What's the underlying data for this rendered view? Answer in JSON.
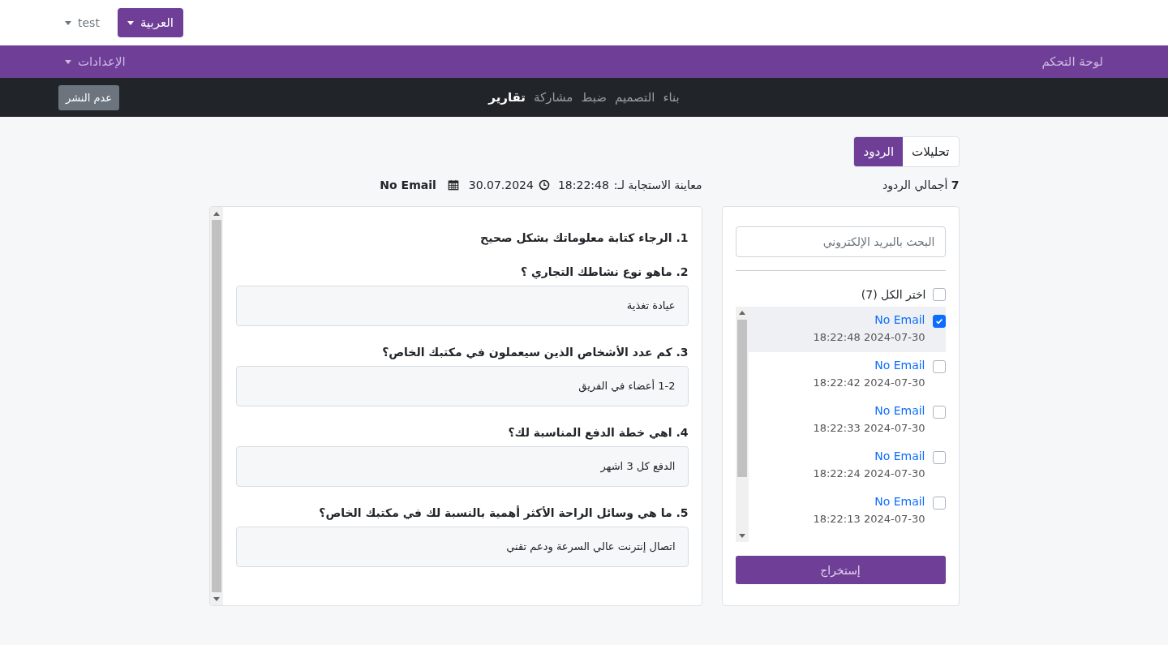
{
  "topbar": {
    "language_button": "العربية",
    "user_menu": "test"
  },
  "menubar": {
    "items": [
      {
        "label": "لوحة التحكم",
        "kind": "link"
      },
      {
        "label": "الإعدادات",
        "kind": "dropdown"
      }
    ]
  },
  "navbar": {
    "tabs": [
      {
        "label": "بناء",
        "selected": false
      },
      {
        "label": "التصميم",
        "selected": false
      },
      {
        "label": "ضبط",
        "selected": false
      },
      {
        "label": "مشاركة",
        "selected": false
      },
      {
        "label": "تقارير",
        "selected": true
      }
    ],
    "unpublish_button": "عدم النشر"
  },
  "view_tabs": [
    {
      "label": "تحليلات",
      "selected": false
    },
    {
      "label": "الردود",
      "selected": true
    }
  ],
  "total": {
    "count": "7",
    "label": "أجمالي الردود"
  },
  "response_header": {
    "label": "معاينة الاستجابة لـ:",
    "time": "18:22:48",
    "date": "30.07.2024",
    "email": "No Email"
  },
  "sidebar": {
    "search_placeholder": "البحث بالبريد الإلكتروني",
    "select_all": {
      "label": "اختر الكل (7)",
      "checked": false
    },
    "responses": [
      {
        "email": "No Email",
        "datetime": "2024-07-30 18:22:48",
        "checked": true,
        "selected": true
      },
      {
        "email": "No Email",
        "datetime": "2024-07-30 18:22:42",
        "checked": false,
        "selected": false
      },
      {
        "email": "No Email",
        "datetime": "2024-07-30 18:22:33",
        "checked": false,
        "selected": false
      },
      {
        "email": "No Email",
        "datetime": "2024-07-30 18:22:24",
        "checked": false,
        "selected": false
      },
      {
        "email": "No Email",
        "datetime": "2024-07-30 18:22:13",
        "checked": false,
        "selected": false
      }
    ],
    "export_button": "إستخراج"
  },
  "answers": [
    {
      "question": "1. الرجاء كتابة معلوماتك بشكل صحيح"
    },
    {
      "question": "2. ماهو نوع نشاطك التجاري ؟",
      "answer": "عيادة تغذية"
    },
    {
      "question": "3. كم عدد الأشخاص الذين سيعملون في مكتبك الخاص؟",
      "answer": "1-2 أعضاء في الفريق"
    },
    {
      "question": "4. اهي خطة الدفع المناسبة لك؟",
      "answer": "الدفع كل 3 اشهر"
    },
    {
      "question": "5. ما هي وسائل الراحة الأكثر أهمية بالنسبة لك في مكتبك الخاص؟",
      "answer": "اتصال إنترنت عالي السرعة ودعم تقني"
    }
  ]
}
